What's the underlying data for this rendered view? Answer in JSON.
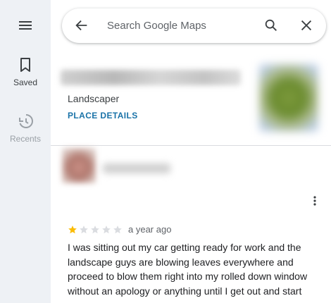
{
  "rail": {
    "menu_icon": "hamburger-menu-icon",
    "saved_label": "Saved",
    "saved_icon": "bookmark-icon",
    "recents_label": "Recents",
    "recents_icon": "history-icon"
  },
  "search": {
    "placeholder": "Search Google Maps",
    "value": "",
    "back_icon": "arrow-back-icon",
    "search_icon": "search-icon",
    "clear_icon": "close-icon"
  },
  "place": {
    "category": "Landscaper",
    "details_link": "PLACE DETAILS"
  },
  "review": {
    "rating": 1,
    "max_rating": 5,
    "date": "a year ago",
    "text": "I was sitting out my car getting ready for work and the landscape guys are blowing leaves everywhere and proceed to blow them right into my rolled down window without an apology or anything until I get out and start",
    "more_icon": "more-vert-icon"
  },
  "colors": {
    "rail_bg": "#eef1f5",
    "link": "#1a73a8",
    "star_filled": "#fbbc04",
    "star_empty": "#dadce0"
  }
}
